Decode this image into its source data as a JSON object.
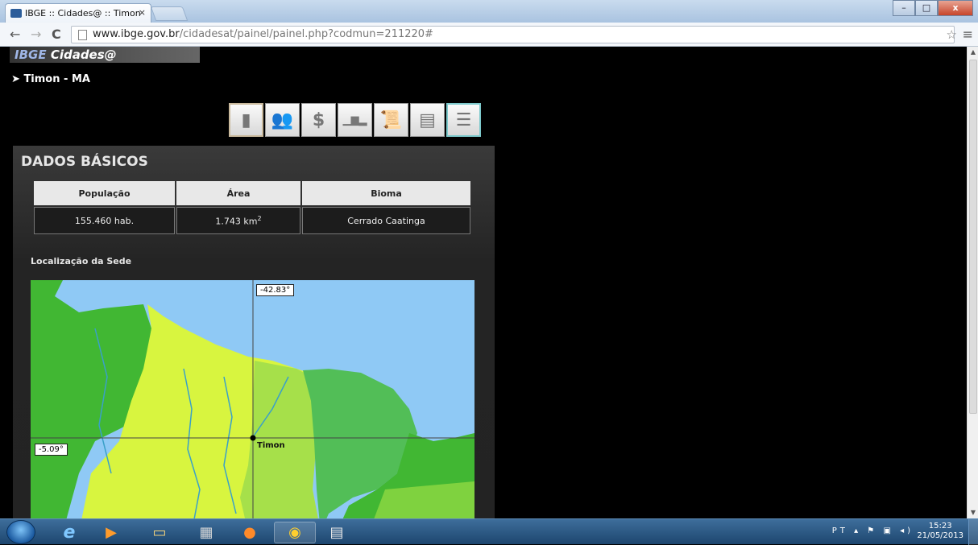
{
  "browser": {
    "tab_title": "IBGE :: Cidades@ :: Timon",
    "tab_close": "×",
    "url_host": "www.ibge.gov.br",
    "url_path": "/cidadesat/painel/painel.php?codmun=211220#",
    "back_glyph": "←",
    "forward_glyph": "→",
    "reload_glyph": "C",
    "star_glyph": "☆",
    "menu_glyph": "≡",
    "minimize": "–",
    "maximize": "□",
    "close": "x"
  },
  "site": {
    "logo_ibge": "IBGE",
    "logo_cidades": "Cidades@",
    "city_marker": "➤",
    "city_name": "Timon - MA"
  },
  "icon_toolbar": [
    {
      "name": "document",
      "glyph": "▮"
    },
    {
      "name": "people",
      "glyph": "👥"
    },
    {
      "name": "dollar",
      "glyph": "$"
    },
    {
      "name": "bar-chart",
      "glyph": "▁▆▂"
    },
    {
      "name": "scroll",
      "glyph": "📜"
    },
    {
      "name": "printer",
      "glyph": "▤"
    },
    {
      "name": "list",
      "glyph": "☰"
    }
  ],
  "dados_basicos": {
    "title": "DADOS BÁSICOS",
    "headers": [
      "População",
      "Área",
      "Bioma"
    ],
    "populacao": "155.460 hab.",
    "area_value": "1.743 km",
    "area_unit_sup": "2",
    "bioma": "Cerrado Caatinga"
  },
  "localizacao": {
    "title": "Localização da Sede",
    "longitude_label": "-42.83°",
    "latitude_label": "-5.09°",
    "city_label": "Timon",
    "colors": {
      "ocean": "#8fc9f5",
      "light_green": "#d8f53f",
      "mid_green": "#a6e04a",
      "dark_green": "#41b733",
      "teal_green": "#52be57"
    }
  },
  "taskbar": {
    "language": "PT",
    "time": "15:23",
    "date": "21/05/2013"
  }
}
